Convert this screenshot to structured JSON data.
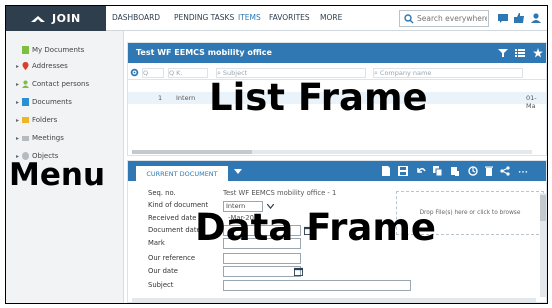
{
  "app": {
    "logo_text": "JOIN"
  },
  "nav": {
    "items": [
      "DASHBOARD",
      "PENDING TASKS",
      "ITEMS",
      "FAVORITES",
      "MORE"
    ],
    "active": "ITEMS"
  },
  "search": {
    "placeholder": "Search everywhere"
  },
  "top_icons": [
    "chat-icon",
    "thumbs-up-icon",
    "user-icon"
  ],
  "sidebar": {
    "items": [
      {
        "label": "My Documents",
        "icon": "document-icon",
        "color": "#7fbf3f"
      },
      {
        "label": "Addresses",
        "icon": "map-pin-icon",
        "color": "#d9402b"
      },
      {
        "label": "Contact persons",
        "icon": "person-icon",
        "color": "#7fbf3f"
      },
      {
        "label": "Documents",
        "icon": "document-icon",
        "color": "#2b8fd6"
      },
      {
        "label": "Folders",
        "icon": "folder-icon",
        "color": "#f0b429"
      },
      {
        "label": "Meetings",
        "icon": "meeting-icon",
        "color": "#9aa6b0"
      },
      {
        "label": "Objects",
        "icon": "object-icon",
        "color": "#9aa6b0"
      }
    ]
  },
  "list": {
    "title": "Test WF EEMCS mobility office",
    "filters": [
      "Q",
      "Q K.",
      "Subject",
      "Company name"
    ],
    "row": {
      "kind": "Intern",
      "number": "1",
      "date_fragment": "01-Ma"
    }
  },
  "detail": {
    "tab_label": "CURRENT DOCUMENT",
    "fields": [
      {
        "label": "Seq. no.",
        "value": "Test WF EEMCS mobility office - 1"
      },
      {
        "label": "Kind of document",
        "value": "Intern"
      },
      {
        "label": "Received date",
        "value": "-Mar-2021"
      },
      {
        "label": "Document date",
        "value": ""
      },
      {
        "label": "Mark",
        "value": ""
      },
      {
        "label": "Our reference",
        "value": ""
      },
      {
        "label": "Our date",
        "value": ""
      },
      {
        "label": "Subject",
        "value": ""
      }
    ],
    "dropzone_text": "Drop File(s) here or click to browse"
  },
  "overlay": {
    "list_frame": "List Frame",
    "menu": "Menu",
    "data_frame": "Data Frame"
  },
  "colors": {
    "brand_dark": "#2f3e4d",
    "accent_blue": "#2f78b3",
    "nav_active": "#2b78b5"
  }
}
